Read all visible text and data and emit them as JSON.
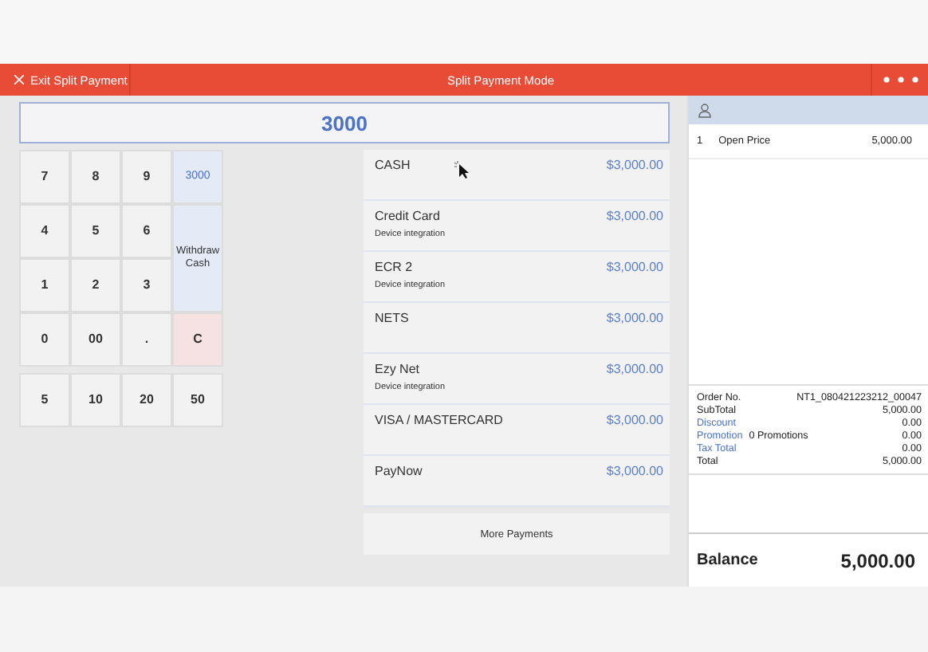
{
  "header": {
    "exit_label": "Exit Split Payment",
    "title": "Split Payment Mode"
  },
  "amount_display": "3000",
  "keypad": {
    "keys": [
      {
        "label": "7",
        "kind": "digit"
      },
      {
        "label": "8",
        "kind": "digit"
      },
      {
        "label": "9",
        "kind": "digit"
      },
      {
        "label": "3000",
        "kind": "preset"
      },
      {
        "label": "4",
        "kind": "digit"
      },
      {
        "label": "5",
        "kind": "digit"
      },
      {
        "label": "6",
        "kind": "digit"
      },
      {
        "label": "Withdraw Cash",
        "kind": "withdraw"
      },
      {
        "label": "1",
        "kind": "digit"
      },
      {
        "label": "2",
        "kind": "digit"
      },
      {
        "label": "3",
        "kind": "digit"
      },
      {
        "label": "0",
        "kind": "digit"
      },
      {
        "label": "00",
        "kind": "digit"
      },
      {
        "label": ".",
        "kind": "digit"
      },
      {
        "label": "C",
        "kind": "clear"
      }
    ],
    "quick_amounts": [
      "5",
      "10",
      "20",
      "50"
    ]
  },
  "payments": [
    {
      "name": "CASH",
      "amount": "$3,000.00"
    },
    {
      "name": "Credit Card",
      "amount": "$3,000.00",
      "note": "Device integration"
    },
    {
      "name": "ECR 2",
      "amount": "$3,000.00",
      "note": "Device integration"
    },
    {
      "name": "NETS",
      "amount": "$3,000.00"
    },
    {
      "name": "Ezy Net",
      "amount": "$3,000.00",
      "note": "Device integration"
    },
    {
      "name": "VISA / MASTERCARD",
      "amount": "$3,000.00"
    },
    {
      "name": "PayNow",
      "amount": "$3,000.00"
    }
  ],
  "more_payments": "More Payments",
  "order_items": [
    {
      "qty": "1",
      "name": "Open Price",
      "amount": "5,000.00"
    }
  ],
  "summary": [
    {
      "label": "Order No.",
      "value": "NT1_080421223212_00047",
      "kind": "plain"
    },
    {
      "label": "SubTotal",
      "value": "5,000.00",
      "kind": "plain"
    },
    {
      "label": "Discount",
      "value": "0.00",
      "kind": "link"
    },
    {
      "label": "Promotion",
      "extra": "0 Promotions",
      "value": "0.00",
      "kind": "link"
    },
    {
      "label": "Tax Total",
      "value": "0.00",
      "kind": "link"
    },
    {
      "label": "Total",
      "value": "5,000.00",
      "kind": "plain"
    }
  ],
  "balance": {
    "label": "Balance",
    "value": "5,000.00"
  }
}
